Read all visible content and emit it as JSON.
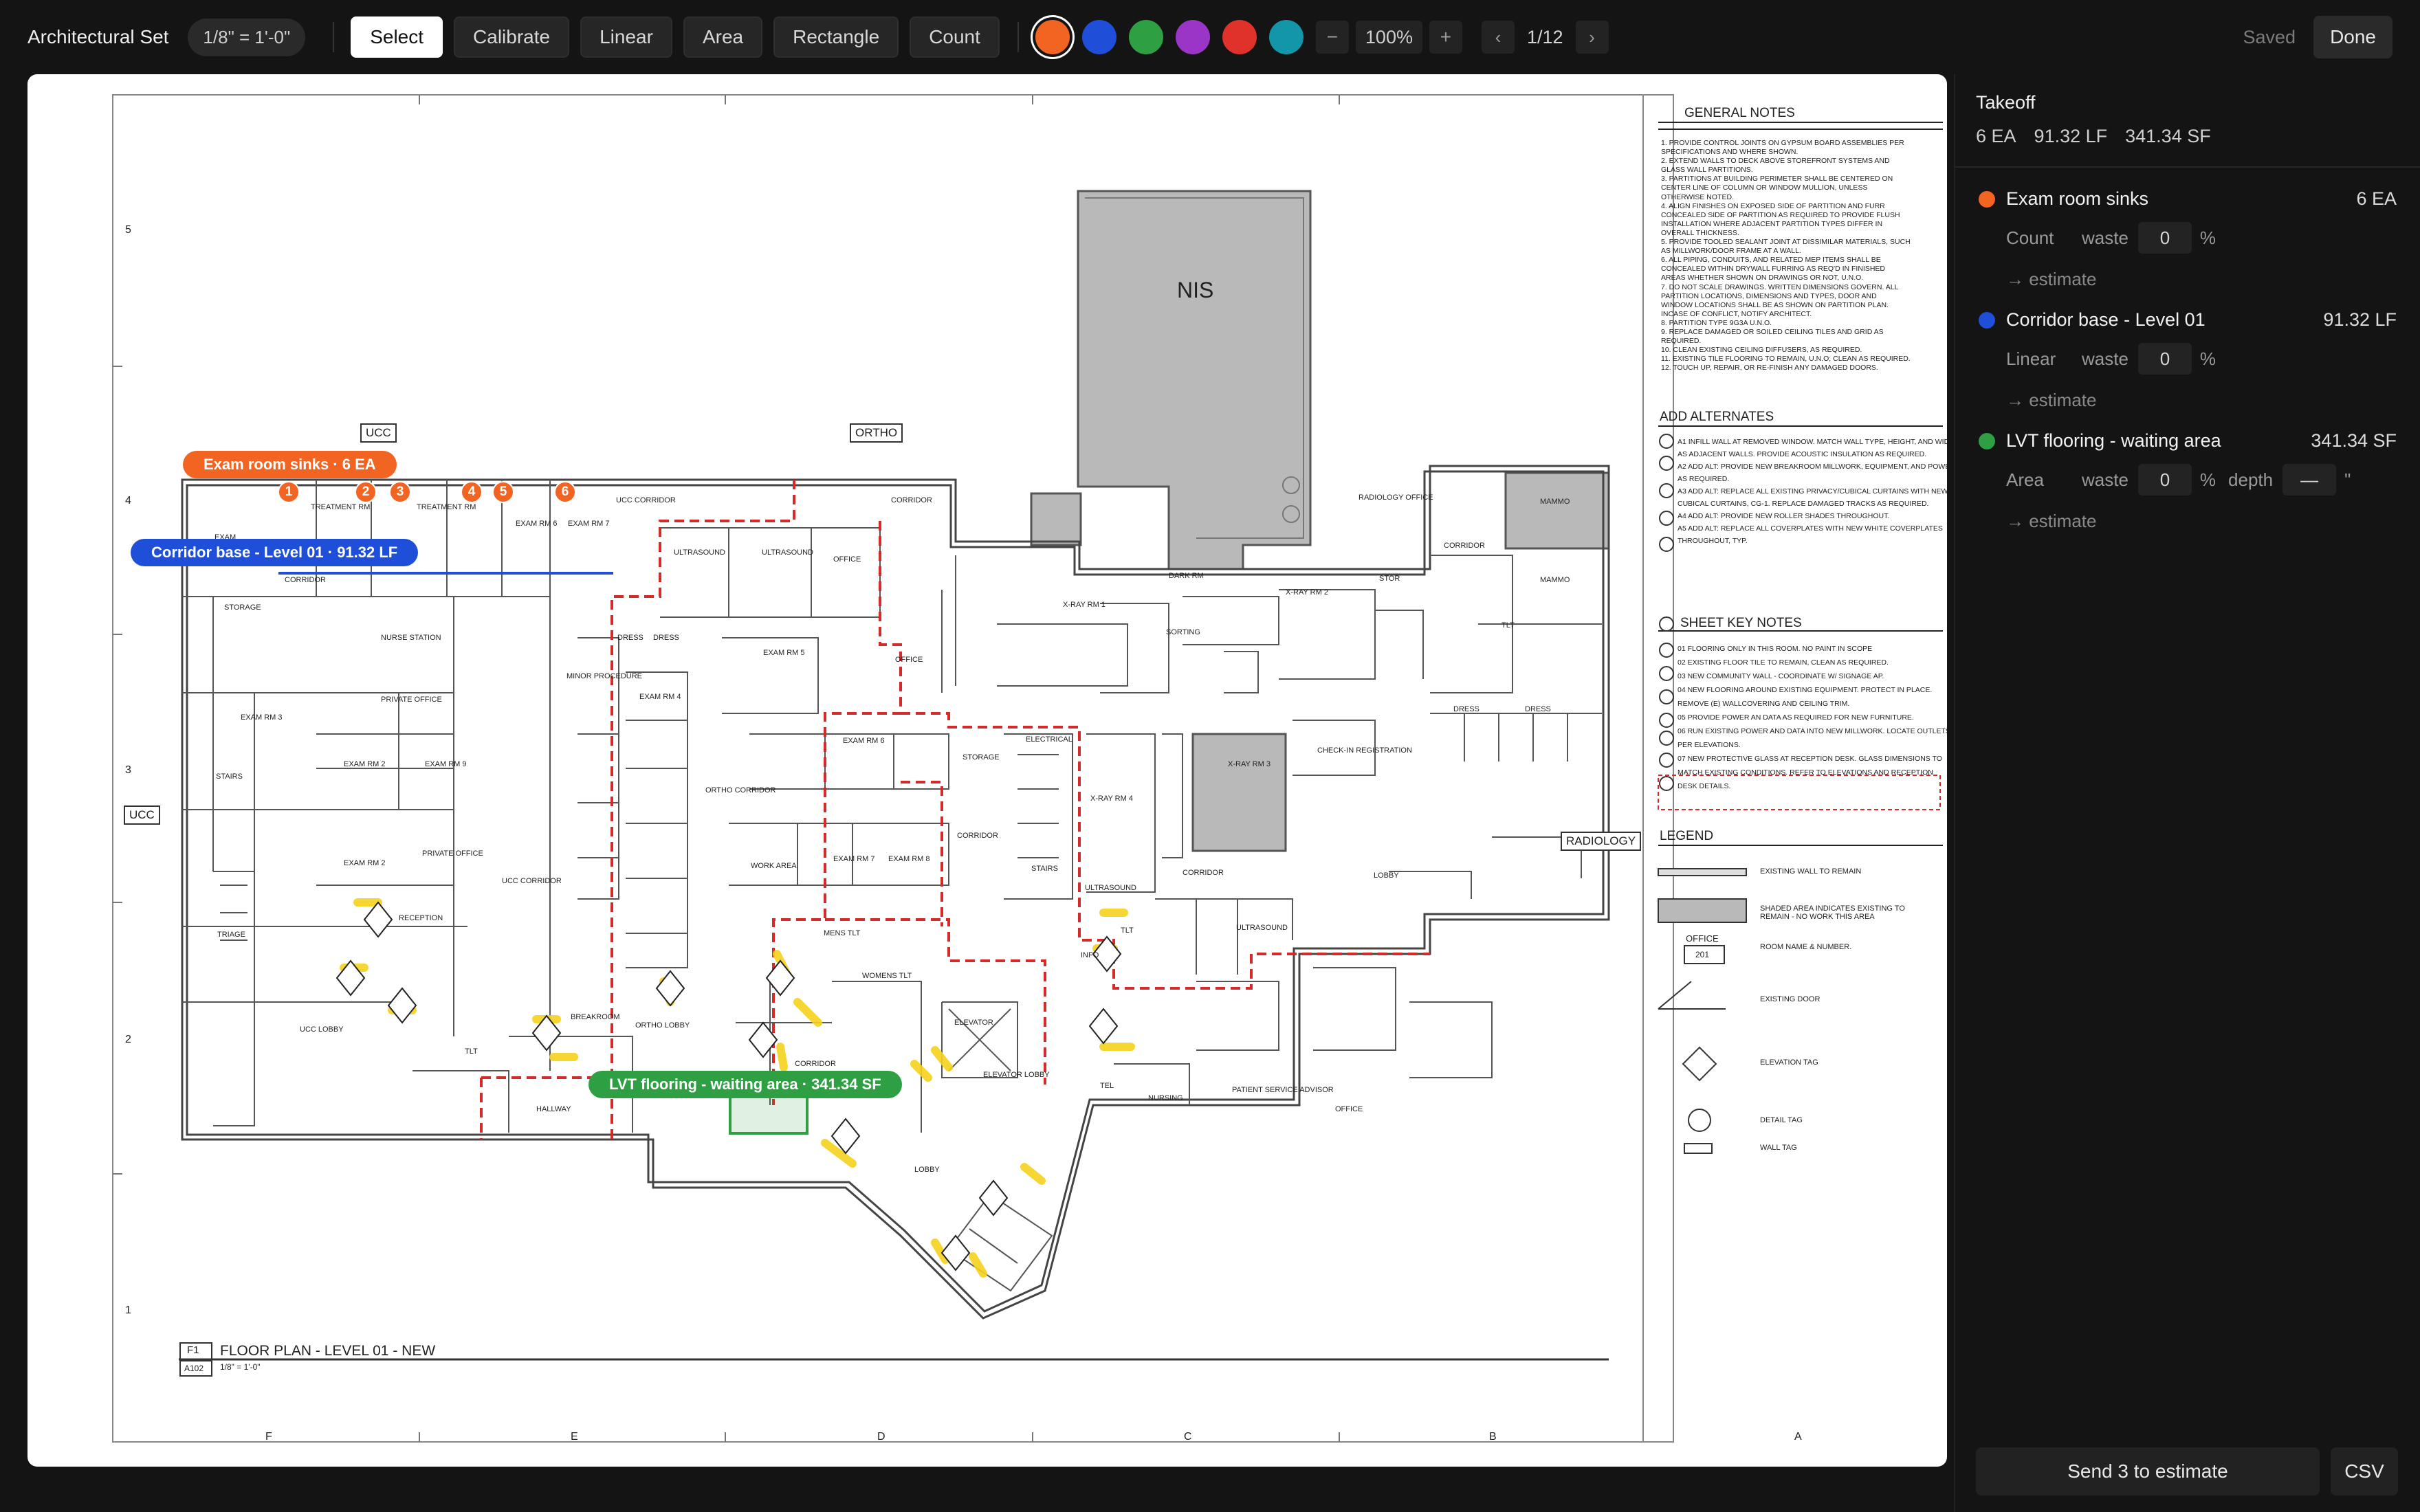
{
  "toolbar": {
    "app_title": "Architectural Set",
    "scale": "1/8\" = 1'-0\"",
    "tools": [
      {
        "label": "Select",
        "active": true
      },
      {
        "label": "Calibrate",
        "active": false
      },
      {
        "label": "Linear",
        "active": false
      },
      {
        "label": "Area",
        "active": false
      },
      {
        "label": "Rectangle",
        "active": false
      },
      {
        "label": "Count",
        "active": false
      }
    ],
    "swatches": [
      "#f26422",
      "#1f4fd8",
      "#2ea043",
      "#9b35c8",
      "#e0322b",
      "#1396a8"
    ],
    "zoom_out": "−",
    "zoom_level": "100%",
    "zoom_in": "+",
    "prev_page": "‹",
    "page": "1/12",
    "next_page": "›",
    "saved": "Saved",
    "done": "Done"
  },
  "sheet": {
    "title": "FLOOR PLAN - LEVEL 01 - NEW",
    "detail_num": "F1",
    "sheet_ref": "A102",
    "scale_note": "1/8\" = 1'-0\"",
    "nis": "NIS",
    "column_labels": [
      "F",
      "E",
      "D",
      "C",
      "B",
      "A"
    ],
    "row_labels": [
      "5",
      "4",
      "3",
      "2",
      "1"
    ],
    "dept_tags": [
      "UCC",
      "ORTHO",
      "UCC",
      "RADIOLOGY"
    ],
    "general_notes_title": "GENERAL NOTES",
    "general_notes": [
      "1. PROVIDE CONTROL JOINTS ON GYPSUM BOARD ASSEMBLIES PER",
      "   SPECIFICATIONS AND WHERE SHOWN.",
      "2. EXTEND WALLS TO DECK ABOVE STOREFRONT SYSTEMS AND",
      "   GLASS WALL PARTITIONS.",
      "3. PARTITIONS AT BUILDING PERIMETER SHALL BE CENTERED ON",
      "   CENTER LINE OF COLUMN OR WINDOW MULLION, UNLESS",
      "   OTHERWISE NOTED.",
      "4. ALIGN FINISHES ON EXPOSED SIDE OF PARTITION AND FURR",
      "   CONCEALED SIDE OF PARTITION AS REQUIRED TO PROVIDE FLUSH",
      "   INSTALLATION WHERE ADJACENT PARTITION TYPES DIFFER IN",
      "   OVERALL THICKNESS.",
      "5. PROVIDE TOOLED SEALANT JOINT AT DISSIMILAR MATERIALS, SUCH",
      "   AS MILLWORK/DOOR FRAME AT A WALL.",
      "6. ALL PIPING, CONDUITS, AND RELATED MEP ITEMS SHALL BE",
      "   CONCEALED WITHIN DRYWALL FURRING AS REQ'D IN FINISHED",
      "   AREAS WHETHER SHOWN ON DRAWINGS OR NOT, U.N.O.",
      "7. DO NOT SCALE DRAWINGS. WRITTEN DIMENSIONS GOVERN. ALL",
      "   PARTITION LOCATIONS, DIMENSIONS AND TYPES, DOOR AND",
      "   WINDOW LOCATIONS SHALL BE AS SHOWN ON PARTITION PLAN.",
      "   INCASE OF CONFLICT, NOTIFY ARCHITECT.",
      "8. PARTITION TYPE 9G3A U.N.O.",
      "9. REPLACE DAMAGED OR SOILED CEILING TILES AND GRID AS",
      "   REQUIRED.",
      "10. CLEAN EXISTING CEILING DIFFUSERS, AS REQUIRED.",
      "11. EXISTING TILE FLOORING TO REMAIN, U.N.O; CLEAN AS REQUIRED.",
      "12. TOUCH UP, REPAIR, OR RE-FINISH ANY DAMAGED DOORS."
    ],
    "add_alternates_title": "ADD ALTERNATES",
    "add_alternates": [
      "A1 INFILL WALL AT REMOVED WINDOW. MATCH WALL TYPE, HEIGHT, AND WIDTH",
      "   AS ADJACENT WALLS. PROVIDE ACOUSTIC INSULATION AS REQUIRED.",
      "A2 ADD ALT: PROVIDE NEW BREAKROOM MILLWORK, EQUIPMENT, AND POWER",
      "   AS REQUIRED.",
      "A3 ADD ALT: REPLACE ALL EXISTING PRIVACY/CUBICAL CURTAINS WITH NEW",
      "   CUBICAL CURTAINS, CG-1. REPLACE DAMAGED TRACKS AS REQUIRED.",
      "A4 ADD ALT: PROVIDE NEW ROLLER SHADES THROUGHOUT.",
      "A5 ADD ALT: REPLACE ALL COVERPLATES WITH NEW WHITE COVERPLATES",
      "   THROUGHOUT, TYP."
    ],
    "key_notes_title": "SHEET KEY NOTES",
    "key_notes": [
      "01 FLOORING ONLY IN THIS ROOM. NO PAINT IN SCOPE",
      "02 EXISTING FLOOR TILE TO REMAIN, CLEAN AS REQUIRED.",
      "03 NEW COMMUNITY WALL - COORDINATE W/ SIGNAGE AP.",
      "04 NEW FLOORING AROUND EXISTING EQUIPMENT. PROTECT IN PLACE.",
      "   REMOVE (E) WALLCOVERING AND CEILING TRIM.",
      "05 PROVIDE POWER AN DATA AS REQUIRED FOR NEW FURNITURE.",
      "06 RUN EXISTING POWER AND DATA INTO NEW MILLWORK. LOCATE OUTLETS",
      "   PER ELEVATIONS.",
      "07 NEW PROTECTIVE GLASS AT RECEPTION DESK. GLASS DIMENSIONS TO",
      "   MATCH EXISTING CONDITIONS. REFER TO ELEVATIONS AND RECEPTION",
      "   DESK DETAILS."
    ],
    "legend_title": "LEGEND",
    "legend": [
      "EXISTING WALL TO REMAIN",
      "SHADED AREA INDICATES EXISTING TO REMAIN - NO WORK THIS AREA",
      "ROOM NAME & NUMBER.",
      "EXISTING DOOR",
      "ELEVATION TAG",
      "DETAIL TAG",
      "WALL TAG"
    ],
    "legend_room_name": "OFFICE",
    "legend_room_num": "201",
    "rooms": [
      "EXAM",
      "TREATMENT RM",
      "TREATMENT RM",
      "EXAM RM 6",
      "EXAM RM 7",
      "UCC CORRIDOR",
      "CORRIDOR",
      "ULTRASOUND",
      "ULTRASOUND",
      "OFFICE",
      "STORAGE",
      "NURSE STATION",
      "PRIVATE OFFICE",
      "EXAM RM 2",
      "EXAM RM 9",
      "STAIRS",
      "DRESS",
      "DRESS",
      "MINOR PROCEDURE",
      "EXAM RM 4",
      "EXAM RM 5",
      "EXAM RM 6",
      "OFFICE",
      "ORTHO CORRIDOR",
      "EXAM RM 3",
      "EXAM RM 2",
      "PRIVATE OFFICE",
      "TRIAGE",
      "RECEPTION",
      "UCC LOBBY",
      "UCC CORRIDOR",
      "TLT",
      "BREAKROOM",
      "ORTHO LOBBY",
      "WORK AREA",
      "EXAM RM 7",
      "EXAM RM 8",
      "MENS TLT",
      "WOMENS TLT",
      "ELEVATOR",
      "CORRIDOR",
      "HALLWAY",
      "ELEVATOR LOBBY",
      "LOBBY",
      "STORAGE",
      "ELECTRICAL",
      "CORRIDOR",
      "STAIRS",
      "X-RAY RM 4",
      "ULTRASOUND",
      "INFO",
      "TLT",
      "X-RAY RM 1",
      "DARK RM",
      "X-RAY RM 2",
      "SORTING",
      "RADIOLOGY OFFICE",
      "STOR",
      "CORRIDOR",
      "MAMMO",
      "MAMMO",
      "TLT",
      "DRESS",
      "DRESS",
      "X-RAY RM 3",
      "CORRIDOR",
      "ULTRASOUND",
      "CHECK-IN REGISTRATION",
      "LOBBY",
      "NURSING",
      "PATIENT SERVICE ADVISOR",
      "OFFICE",
      "TEL",
      "CORRIDOR"
    ]
  },
  "annotations": {
    "count_chip": "Exam room sinks · 6 EA",
    "count_pins": [
      "1",
      "2",
      "3",
      "4",
      "5",
      "6"
    ],
    "linear_chip": "Corridor base - Level 01 · 91.32 LF",
    "area_chip": "LVT flooring - waiting area · 341.34 SF"
  },
  "sidebar": {
    "title": "Takeoff",
    "totals": [
      "6 EA",
      "91.32 LF",
      "341.34 SF"
    ],
    "items": [
      {
        "name": "Exam room sinks",
        "qty": "6 EA",
        "color": "#f26422",
        "type": "Count",
        "waste_label": "waste",
        "waste": "0",
        "pct": "%",
        "estimate": "→ estimate"
      },
      {
        "name": "Corridor base - Level 01",
        "qty": "91.32 LF",
        "color": "#1f4fd8",
        "type": "Linear",
        "waste_label": "waste",
        "waste": "0",
        "pct": "%",
        "estimate": "→ estimate"
      },
      {
        "name": "LVT flooring - waiting area",
        "qty": "341.34 SF",
        "color": "#2ea043",
        "type": "Area",
        "waste_label": "waste",
        "waste": "0",
        "pct": "%",
        "depth_label": "depth",
        "depth": "—",
        "depth_unit": "\"",
        "estimate": "→ estimate"
      }
    ],
    "send_label": "Send 3 to estimate",
    "csv_label": "CSV"
  }
}
